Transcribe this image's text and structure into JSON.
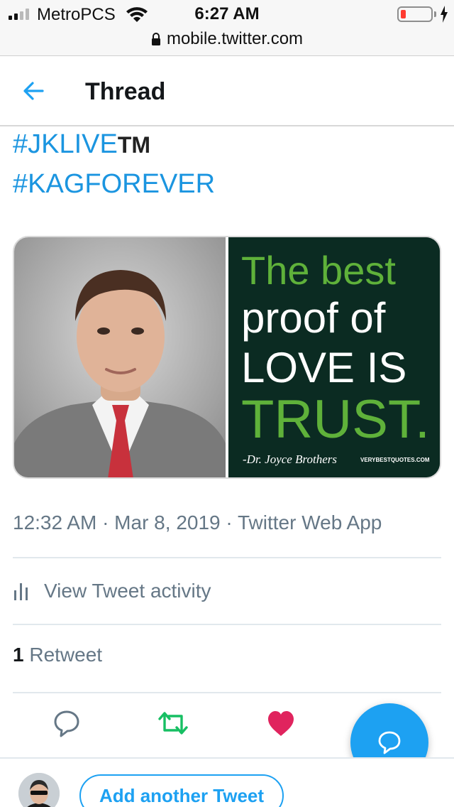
{
  "status_bar": {
    "carrier": "MetroPCS",
    "time": "6:27 AM",
    "battery_color": "#ff3b30"
  },
  "browser": {
    "url": "mobile.twitter.com",
    "lock_icon": "lock-icon"
  },
  "header": {
    "back_icon": "back-arrow-icon",
    "title": "Thread"
  },
  "tweet": {
    "hashtag_1": "#JKLIVE",
    "hashtag_1_suffix": "TM",
    "hashtag_2": "#KAGFOREVER",
    "media_quote": {
      "line1": "The best",
      "line2": "proof of",
      "line3": "LOVE IS",
      "line4": "TRUST.",
      "attribution": "-Dr. Joyce Brothers",
      "source": "VERYBESTQUOTES.COM"
    },
    "timestamp": "12:32 AM · Mar 8, 2019 · Twitter Web App",
    "activity_label": "View Tweet activity",
    "retweet_count": "1",
    "retweet_label": "Retweet"
  },
  "actions": {
    "reply_icon": "reply-icon",
    "retweet_icon": "retweet-icon",
    "like_icon": "heart-icon",
    "retweet_color": "#17bf63",
    "like_color": "#e0245e"
  },
  "composer": {
    "add_label": "Add another Tweet",
    "fab_icon": "compose-reply-icon",
    "accent": "#1da1f2"
  }
}
